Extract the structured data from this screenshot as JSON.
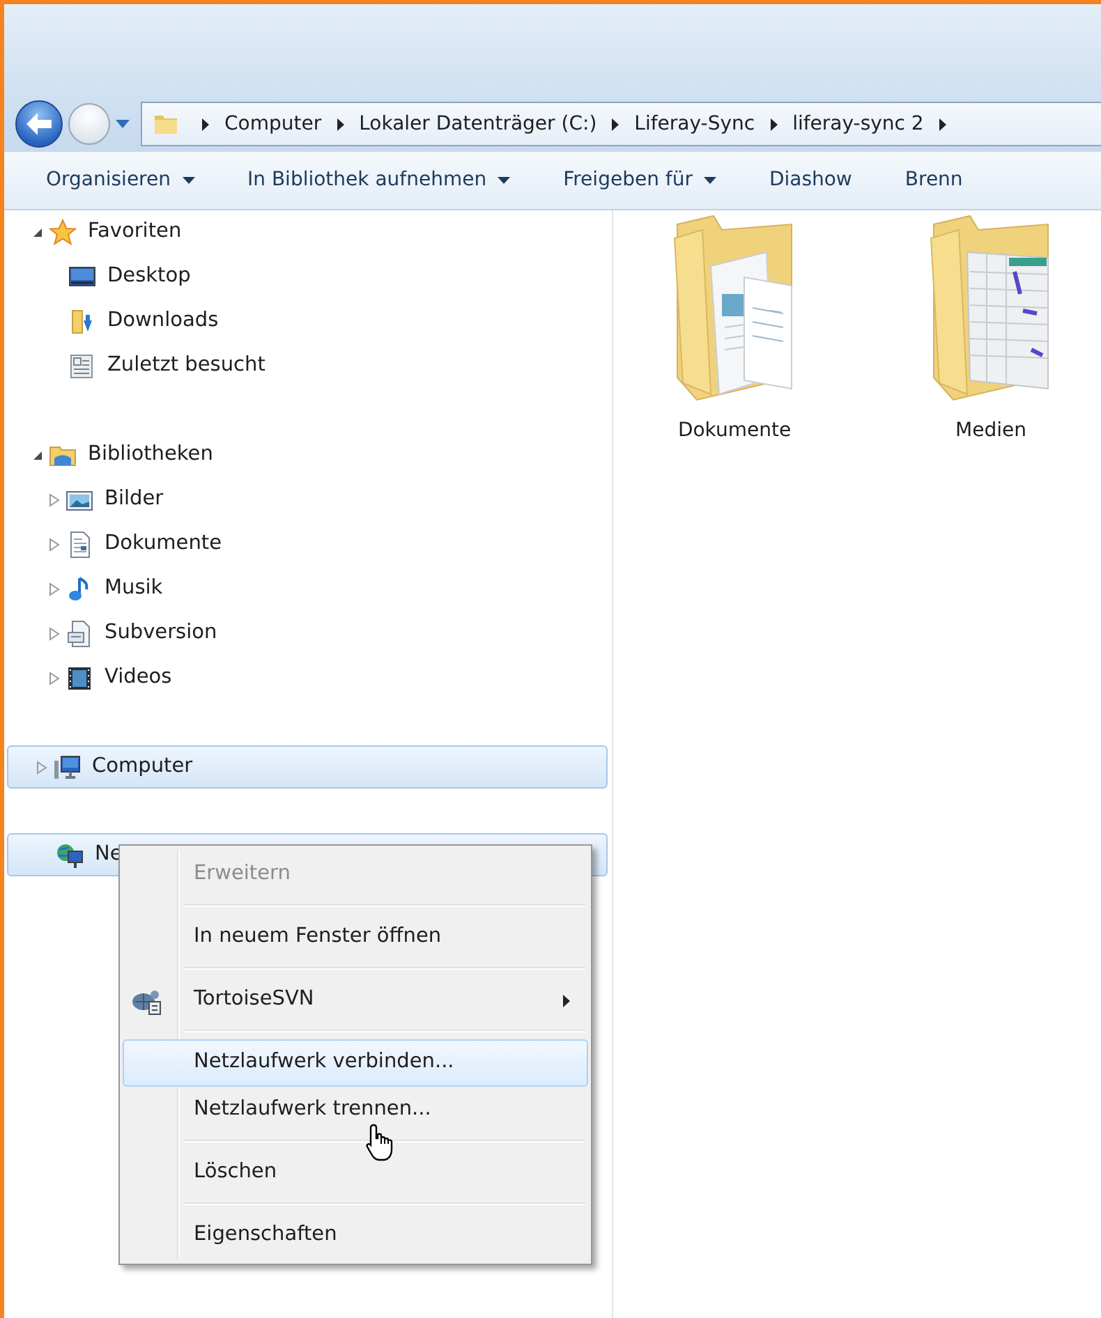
{
  "address_bar": {
    "crumbs": [
      "Computer",
      "Lokaler Datenträger (C:)",
      "Liferay-Sync",
      "liferay-sync 2"
    ]
  },
  "toolbar": [
    {
      "label": "Organisieren",
      "dropdown": true
    },
    {
      "label": "In Bibliothek aufnehmen",
      "dropdown": true
    },
    {
      "label": "Freigeben für",
      "dropdown": true
    },
    {
      "label": "Diashow",
      "dropdown": false
    },
    {
      "label": "Brenn",
      "dropdown": false
    }
  ],
  "navigation": [
    {
      "label": "Favoriten",
      "kind": "favorites",
      "expanded": true,
      "highlighted": false,
      "children": [
        {
          "label": "Desktop",
          "kind": "desktop"
        },
        {
          "label": "Downloads",
          "kind": "downloads"
        },
        {
          "label": "Zuletzt besucht",
          "kind": "recent"
        }
      ]
    },
    {
      "label": "Bibliotheken",
      "kind": "libraries",
      "expanded": true,
      "highlighted": false,
      "children": [
        {
          "label": "Bilder",
          "kind": "pictures",
          "expanded": false
        },
        {
          "label": "Dokumente",
          "kind": "documents",
          "expanded": false
        },
        {
          "label": "Musik",
          "kind": "music",
          "expanded": false
        },
        {
          "label": "Subversion",
          "kind": "subversion",
          "expanded": false
        },
        {
          "label": "Videos",
          "kind": "videos",
          "expanded": false
        }
      ]
    },
    {
      "label": "Computer",
      "kind": "computer",
      "expanded": false,
      "highlighted": true
    },
    {
      "label": "Ne",
      "kind": "network",
      "highlighted": true
    }
  ],
  "content": {
    "items": [
      {
        "label": "Dokumente",
        "kind": "documents"
      },
      {
        "label": "Medien",
        "kind": "media"
      }
    ]
  },
  "context_menu": {
    "items": [
      {
        "kind": "item",
        "label": "Erweitern",
        "disabled": true,
        "selected": false
      },
      {
        "kind": "separator"
      },
      {
        "kind": "item",
        "label": "In neuem Fenster öffnen",
        "disabled": false,
        "selected": false
      },
      {
        "kind": "separator"
      },
      {
        "kind": "submenu",
        "label": "TortoiseSVN",
        "disabled": false,
        "selected": false
      },
      {
        "kind": "separator"
      },
      {
        "kind": "item",
        "label": "Netzlaufwerk verbinden...",
        "disabled": false,
        "selected": true
      },
      {
        "kind": "item",
        "label": "Netzlaufwerk trennen...",
        "disabled": false,
        "selected": false
      },
      {
        "kind": "separator"
      },
      {
        "kind": "item",
        "label": "Löschen",
        "disabled": false,
        "selected": false
      },
      {
        "kind": "separator"
      },
      {
        "kind": "item",
        "label": "Eigenschaften",
        "disabled": false,
        "selected": false
      }
    ]
  }
}
